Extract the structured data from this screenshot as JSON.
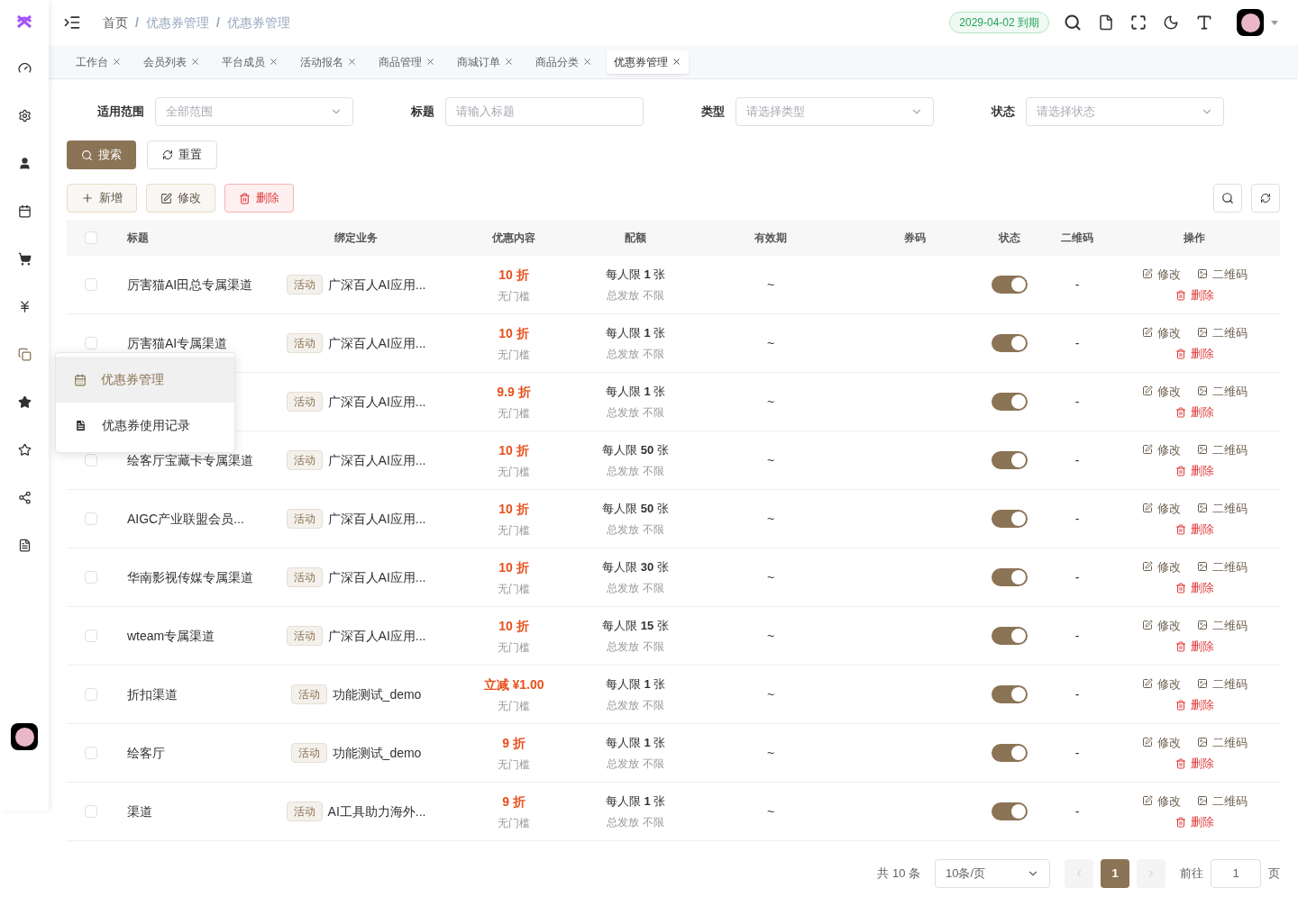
{
  "breadcrumb": [
    "首页",
    "优惠券管理",
    "优惠券管理"
  ],
  "breadcrumb_separators": [
    "/",
    "/"
  ],
  "select_all_checked": false,
  "expiry_badge": "2029-04-02 到期",
  "tabs": [
    {
      "label": "工作台",
      "selected": false
    },
    {
      "label": "会员列表",
      "selected": false
    },
    {
      "label": "平台成员",
      "selected": false
    },
    {
      "label": "活动报名",
      "selected": false
    },
    {
      "label": "商品管理",
      "selected": false
    },
    {
      "label": "商城订单",
      "selected": false
    },
    {
      "label": "商品分类",
      "selected": false
    },
    {
      "label": "优惠券管理",
      "selected": true
    }
  ],
  "filters": [
    {
      "label": "适用范围",
      "kind": "select",
      "placeholder": "全部范围"
    },
    {
      "label": "标题",
      "kind": "input",
      "placeholder": "请输入标题"
    },
    {
      "label": "类型",
      "kind": "select",
      "placeholder": "请选择类型"
    },
    {
      "label": "状态",
      "kind": "select",
      "placeholder": "请选择状态"
    }
  ],
  "search_button": "搜索",
  "reset_button": "重置",
  "actions": [
    {
      "label": "新增",
      "kind": "add"
    },
    {
      "label": "修改",
      "kind": "edit"
    },
    {
      "label": "删除",
      "kind": "delete"
    }
  ],
  "columns": [
    "标题",
    "绑定业务",
    "优惠内容",
    "配额",
    "有效期",
    "券码",
    "状态",
    "二维码",
    "操作"
  ],
  "rows": [
    {
      "checked": false,
      "title": "厉害猫AI田总专属渠道",
      "tag": "活动",
      "business": "广深百人AI应用...",
      "discount": "10 折",
      "threshold": "无门槛",
      "quota": "每人限 **1** 张",
      "total": "总发放 不限",
      "validity": "~",
      "qrcode": "-",
      "on": true,
      "actions": [
        "修改",
        "二维码",
        "删除"
      ]
    },
    {
      "checked": false,
      "title": "厉害猫AI专属渠道",
      "tag": "活动",
      "business": "广深百人AI应用...",
      "discount": "10 折",
      "threshold": "无门槛",
      "quota": "每人限 **1** 张",
      "total": "总发放 不限",
      "validity": "~",
      "qrcode": "-",
      "on": true,
      "actions": [
        "修改",
        "二维码",
        "删除"
      ]
    },
    {
      "tag": "活动",
      "business": "广深百人AI应用...",
      "discount": "9.9 折",
      "threshold": "无门槛",
      "quota": "每人限 **1** 张",
      "total": "总发放 不限",
      "validity": "~",
      "qrcode": "-",
      "on": true,
      "actions": [
        "修改",
        "二维码",
        "删除"
      ]
    },
    {
      "checked": false,
      "title": "绘客厅宝藏卡专属渠道",
      "tag": "活动",
      "business": "广深百人AI应用...",
      "discount": "10 折",
      "threshold": "无门槛",
      "quota": "每人限 **50** 张",
      "total": "总发放 不限",
      "validity": "~",
      "qrcode": "-",
      "on": true,
      "actions": [
        "修改",
        "二维码",
        "删除"
      ]
    },
    {
      "checked": false,
      "title": "AIGC产业联盟会员...",
      "tag": "活动",
      "business": "广深百人AI应用...",
      "discount": "10 折",
      "threshold": "无门槛",
      "quota": "每人限 **50** 张",
      "total": "总发放 不限",
      "validity": "~",
      "qrcode": "-",
      "on": true,
      "actions": [
        "修改",
        "二维码",
        "删除"
      ]
    },
    {
      "checked": false,
      "title": "华南影视传媒专属渠道",
      "tag": "活动",
      "business": "广深百人AI应用...",
      "discount": "10 折",
      "threshold": "无门槛",
      "quota": "每人限 **30** 张",
      "total": "总发放 不限",
      "validity": "~",
      "qrcode": "-",
      "on": true,
      "actions": [
        "修改",
        "二维码",
        "删除"
      ]
    },
    {
      "checked": false,
      "title": "wteam专属渠道",
      "tag": "活动",
      "business": "广深百人AI应用...",
      "discount": "10 折",
      "threshold": "无门槛",
      "quota": "每人限 **15** 张",
      "total": "总发放 不限",
      "validity": "~",
      "qrcode": "-",
      "on": true,
      "actions": [
        "修改",
        "二维码",
        "删除"
      ]
    },
    {
      "checked": false,
      "title": "折扣渠道",
      "tag": "活动",
      "business": "功能测试_demo",
      "discount": "立减 ¥1.00",
      "threshold": "无门槛",
      "quota": "每人限 **1** 张",
      "total": "总发放 不限",
      "validity": "~",
      "qrcode": "-",
      "on": true,
      "actions": [
        "修改",
        "二维码",
        "删除"
      ]
    },
    {
      "checked": false,
      "title": "绘客厅",
      "tag": "活动",
      "business": "功能测试_demo",
      "discount": "9 折",
      "threshold": "无门槛",
      "quota": "每人限 **1** 张",
      "total": "总发放 不限",
      "validity": "~",
      "qrcode": "-",
      "on": true,
      "actions": [
        "修改",
        "二维码",
        "删除"
      ]
    },
    {
      "checked": false,
      "title": "渠道",
      "tag": "活动",
      "business": "AI工具助力海外...",
      "discount": "9 折",
      "threshold": "无门槛",
      "quota": "每人限 **1** 张",
      "total": "总发放 不限",
      "validity": "~",
      "qrcode": "-",
      "on": true,
      "actions": [
        "修改",
        "二维码",
        "删除"
      ]
    }
  ],
  "popup_menu": [
    {
      "label": "优惠券管理",
      "selected": true
    },
    {
      "label": "优惠券使用记录",
      "selected": false
    }
  ],
  "pagination": {
    "total": "共 10 条",
    "page_size": "10条/页",
    "current_page": "1",
    "goto_label": "前往",
    "goto_value": "1",
    "page_suffix": "页"
  }
}
